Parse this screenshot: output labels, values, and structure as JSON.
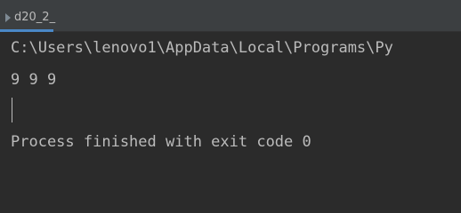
{
  "tab": {
    "label": "d20_2_"
  },
  "console": {
    "command_line": "C:\\Users\\lenovo1\\AppData\\Local\\Programs\\Py",
    "output_line": "9 9 9",
    "exit_message": "Process finished with exit code 0"
  }
}
